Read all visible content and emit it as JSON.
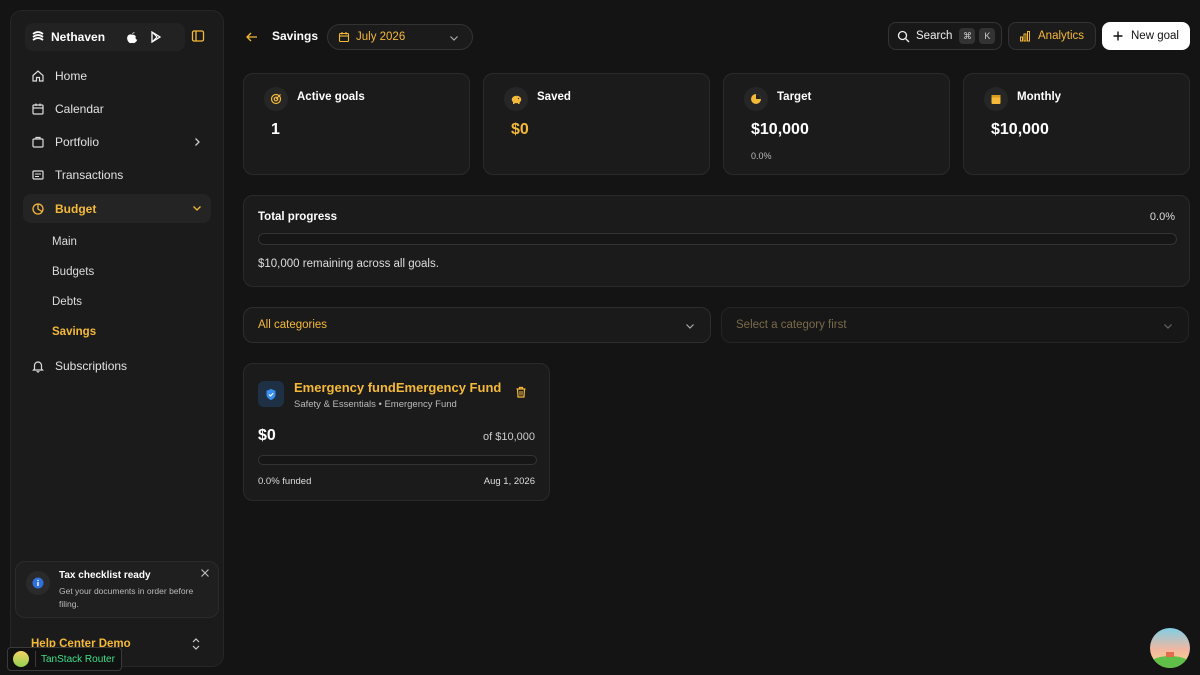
{
  "app": {
    "name": "Nethaven"
  },
  "colors": {
    "accent": "#f5b93a",
    "background": "#141414",
    "card": "#1b1b1b"
  },
  "sidebar": {
    "nav": [
      {
        "label": "Home",
        "icon": "home-icon"
      },
      {
        "label": "Calendar",
        "icon": "calendar-icon"
      },
      {
        "label": "Portfolio",
        "icon": "briefcase-icon"
      },
      {
        "label": "Transactions",
        "icon": "receipt-icon"
      },
      {
        "label": "Budget",
        "icon": "pie-chart-icon"
      }
    ],
    "budget_sub": [
      "Main",
      "Budgets",
      "Debts",
      "Savings"
    ],
    "subscriptions": "Subscriptions",
    "toast": {
      "title": "Tax checklist ready",
      "body": "Get your documents in order before filing."
    },
    "help": "Help Center Demo"
  },
  "devtools": {
    "label": "TanStack Router"
  },
  "header": {
    "crumb": "Savings",
    "month": "July 2026",
    "search": "Search",
    "kbd_cmd": "⌘",
    "kbd_key": "K",
    "analytics": "Analytics",
    "new_goal": "New goal"
  },
  "stats": [
    {
      "label": "Active goals",
      "value": "1",
      "sub": ""
    },
    {
      "label": "Saved",
      "value": "$0",
      "sub": ""
    },
    {
      "label": "Target",
      "value": "$10,000",
      "sub": "0.0%"
    },
    {
      "label": "Monthly",
      "value": "$10,000",
      "sub": ""
    }
  ],
  "progress": {
    "title": "Total progress",
    "percent": "0.0%",
    "fraction": 0,
    "remaining": "$10,000 remaining across all goals."
  },
  "filters": {
    "category": "All categories",
    "subcategory": "Select a category first"
  },
  "goal": {
    "title": "Emergency fundEmergency Fund",
    "subtitle": "Safety & Essentials • Emergency Fund",
    "saved": "$0",
    "of": "of $10,000",
    "funded": "0.0% funded",
    "fraction": 0,
    "date": "Aug 1, 2026"
  }
}
